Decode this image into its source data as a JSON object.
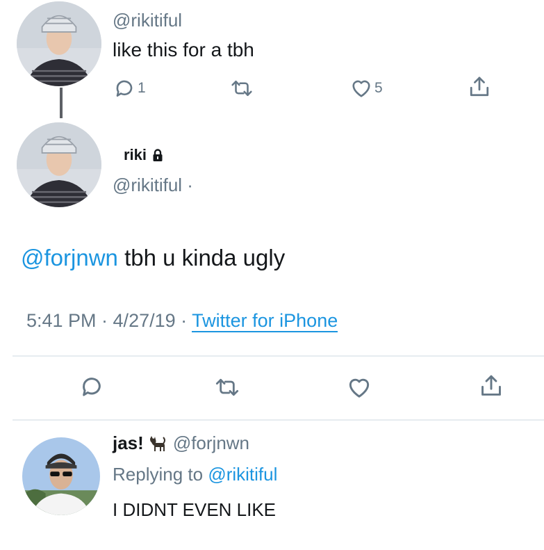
{
  "tweet1": {
    "handle": "@rikitiful",
    "text": "like this for a tbh",
    "reply_count": "1",
    "like_count": "5"
  },
  "tweet2": {
    "display_name": "riki",
    "handle": "@rikitiful ·",
    "mention": "@forjnwn",
    "text": "tbh u kinda ugly",
    "meta_prefix": "5:41 PM · 4/27/19 · ",
    "source": "Twitter for iPhone"
  },
  "tweet3": {
    "display_name": "jas!",
    "handle": "@forjnwn",
    "replying_prefix": "Replying to ",
    "replying_to": "@rikitiful",
    "text": "I DIDNT EVEN LIKE"
  },
  "icons": {
    "reply": "reply-icon",
    "retweet": "retweet-icon",
    "like": "heart-icon",
    "share": "share-icon",
    "lock": "lock-icon",
    "cat": "cat-emoji-icon"
  },
  "colors": {
    "link": "#1b95e0",
    "secondary": "#657786",
    "primary": "#14171a",
    "divider": "#e6ecf0"
  }
}
